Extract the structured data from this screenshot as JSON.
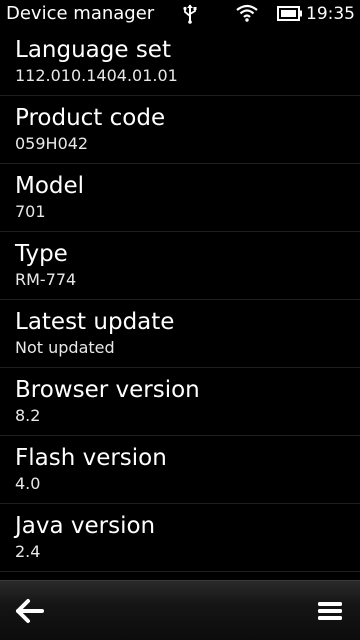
{
  "status_bar": {
    "title": "Device manager",
    "time": "19:35",
    "icons": [
      "usb-icon",
      "wifi-icon",
      "battery-icon"
    ]
  },
  "details": [
    {
      "label": "Language set",
      "value": "112.010.1404.01.01"
    },
    {
      "label": "Product code",
      "value": "059H042"
    },
    {
      "label": "Model",
      "value": "701"
    },
    {
      "label": "Type",
      "value": "RM-774"
    },
    {
      "label": "Latest update",
      "value": "Not updated"
    },
    {
      "label": "Browser version",
      "value": "8.2"
    },
    {
      "label": "Flash version",
      "value": "4.0"
    },
    {
      "label": "Java version",
      "value": "2.4"
    }
  ],
  "toolbar": {
    "back_icon": "back-arrow-icon",
    "menu_icon": "menu-icon"
  }
}
